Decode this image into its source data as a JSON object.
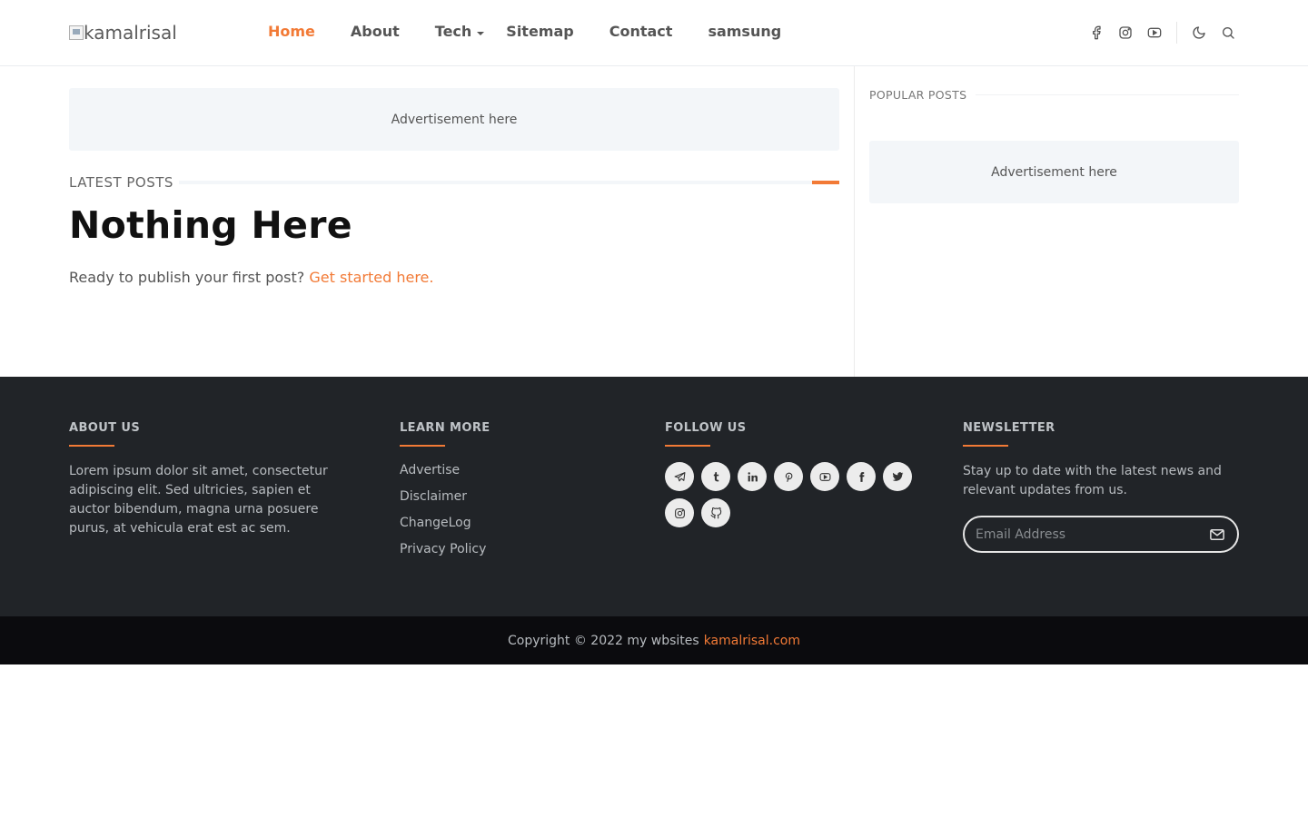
{
  "header": {
    "logo_alt": "kamalrisal",
    "nav": [
      {
        "label": "Home"
      },
      {
        "label": "About"
      },
      {
        "label": "Tech"
      },
      {
        "label": "Sitemap"
      },
      {
        "label": "Contact"
      },
      {
        "label": "samsung"
      }
    ],
    "icons": [
      "facebook-icon",
      "instagram-icon",
      "youtube-icon",
      "moon-icon",
      "search-icon"
    ]
  },
  "main": {
    "ad_text": "Advertisement here",
    "section_title": "LATEST POSTS",
    "heading": "Nothing Here",
    "publish_text": "Ready to publish your first post?",
    "publish_link": "Get started here."
  },
  "sidebar": {
    "title": "POPULAR POSTS",
    "ad_text": "Advertisement here"
  },
  "footer": {
    "about": {
      "title": "ABOUT US",
      "text": "Lorem ipsum dolor sit amet, consectetur adipiscing elit. Sed ultricies, sapien et auctor bibendum, magna urna posuere purus, at vehicula erat est ac sem."
    },
    "learn": {
      "title": "LEARN MORE",
      "links": [
        "Advertise",
        "Disclaimer",
        "ChangeLog",
        "Privacy Policy"
      ]
    },
    "follow": {
      "title": "FOLLOW US",
      "icons": [
        "telegram-icon",
        "tumblr-icon",
        "linkedin-icon",
        "pinterest-icon",
        "youtube-icon",
        "facebook-icon",
        "twitter-icon",
        "instagram-icon",
        "github-icon"
      ]
    },
    "newsletter": {
      "title": "NEWSLETTER",
      "text": "Stay up to date with the latest news and relevant updates from us.",
      "placeholder": "Email Address"
    },
    "copyright": "Copyright © 2022 my wbsites",
    "copyright_link": "kamalrisal.com"
  },
  "colors": {
    "accent": "#f27a36",
    "footer_bg": "#212428",
    "copy_bg": "#0b0b0e"
  }
}
